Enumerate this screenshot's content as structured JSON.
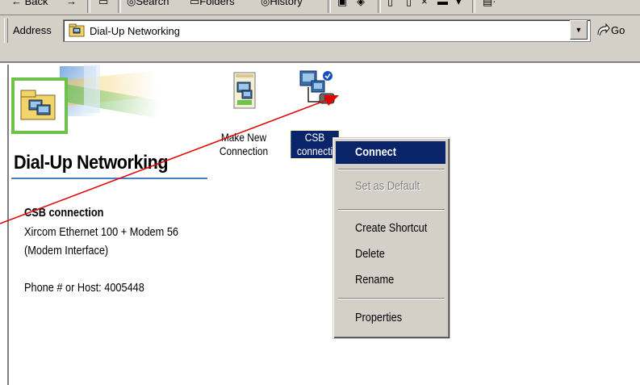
{
  "toolbar": {
    "back_label": "← Back",
    "forward_label": "→",
    "search_label": "Search",
    "folders_label": "Folders",
    "history_label": "History"
  },
  "address_bar": {
    "label": "Address",
    "value": "Dial-Up Networking",
    "go_label": "Go"
  },
  "panel": {
    "title": "Dial-Up Networking",
    "selected_name": "CSB connection",
    "selected_desc_line1": "Xircom Ethernet 100 + Modem 56",
    "selected_desc_line2": "(Modem Interface)",
    "selected_phone": "Phone # or Host: 4005448"
  },
  "icons": {
    "make_new_line1": "Make New",
    "make_new_line2": "Connection",
    "csb_line1": "CSB",
    "csb_line2": "connecti"
  },
  "context_menu": {
    "connect": "Connect",
    "set_default": "Set as Default",
    "create_shortcut": "Create Shortcut",
    "delete": "Delete",
    "rename": "Rename",
    "properties": "Properties"
  },
  "colors": {
    "selection": "#0a246a",
    "chrome": "#d4d0c8",
    "arrow": "#e00000"
  }
}
